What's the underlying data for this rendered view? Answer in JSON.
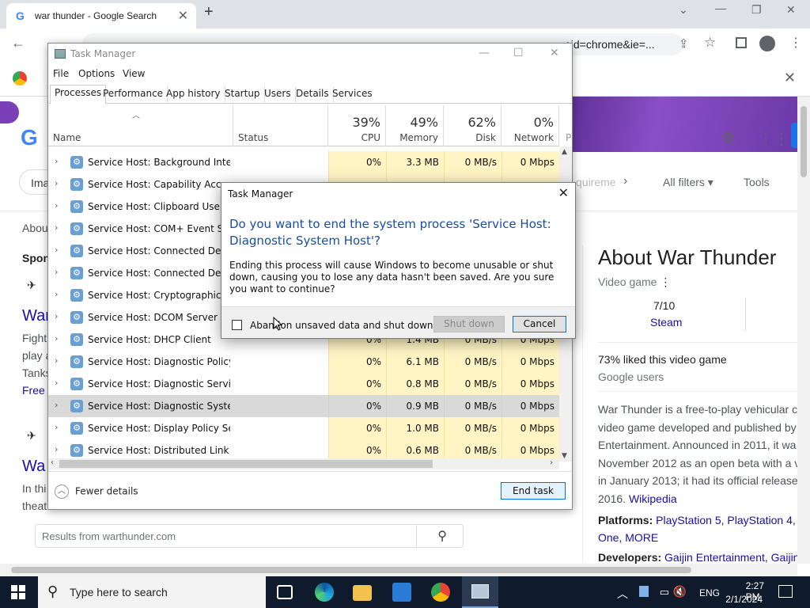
{
  "browser": {
    "tab_title": "war thunder - Google Search",
    "tab_favicon": "G",
    "omnibox_fragment": "eid=chrome&ie=..."
  },
  "page": {
    "images_tab": "Ima",
    "requirements_fragment": "quireme",
    "all_filters": "All filters",
    "tools": "Tools",
    "left_about": "Abou",
    "left_sponsored": "Spon",
    "left_link_1": "War",
    "left_text_1": "Fight",
    "left_text_2": "play a",
    "left_text_3": "Tanks",
    "left_free": "Free",
    "left_link_2": "Wa",
    "left_text_4": "In thi",
    "left_text_5": "theat",
    "results_from": "Results from warthunder.com"
  },
  "knowledge_panel": {
    "title": "About War Thunder",
    "subtitle": "Video game",
    "rating": "7/10",
    "rating_source": "Steam",
    "liked": "73% liked this video game",
    "liked_source": "Google users",
    "description_lines": [
      "War Thunder is a free-to-play vehicular c",
      "video game developed and published by",
      "Entertainment. Announced in 2011, it wa",
      "November 2012 as an open beta with a v",
      "in January 2013; it had its official release",
      "2016."
    ],
    "wikipedia": "Wikipedia",
    "platforms_label": "Platforms:",
    "platforms_value": "PlayStation 5, PlayStation 4,",
    "platforms_more": "One, MORE",
    "developers_label": "Developers:",
    "developers_value": "Gaijin Entertainment, Gaijin"
  },
  "task_manager": {
    "title": "Task Manager",
    "menu": [
      "File",
      "Options",
      "View"
    ],
    "tabs": [
      "Processes",
      "Performance",
      "App history",
      "Startup",
      "Users",
      "Details",
      "Services"
    ],
    "columns": {
      "name": "Name",
      "status": "Status",
      "cpu": {
        "pct": "39%",
        "label": "CPU"
      },
      "memory": {
        "pct": "49%",
        "label": "Memory"
      },
      "disk": {
        "pct": "62%",
        "label": "Disk"
      },
      "network": {
        "pct": "0%",
        "label": "Network"
      },
      "power_fragment": "P"
    },
    "rows": [
      {
        "name": "Service Host: Background Intelli...",
        "cpu": "0%",
        "mem": "3.3 MB",
        "disk": "0 MB/s",
        "net": "0 Mbps"
      },
      {
        "name": "Service Host: Capability Access ...",
        "cpu": "",
        "mem": "",
        "disk": "",
        "net": ""
      },
      {
        "name": "Service Host: Clipboard User Ser...",
        "cpu": "",
        "mem": "",
        "disk": "",
        "net": ""
      },
      {
        "name": "Service Host: COM+ Event Syste...",
        "cpu": "",
        "mem": "",
        "disk": "",
        "net": ""
      },
      {
        "name": "Service Host: Connected Device...",
        "cpu": "",
        "mem": "",
        "disk": "",
        "net": ""
      },
      {
        "name": "Service Host: Connected Device...",
        "cpu": "",
        "mem": "",
        "disk": "",
        "net": ""
      },
      {
        "name": "Service Host: Cryptographic Ser...",
        "cpu": "",
        "mem": "",
        "disk": "",
        "net": ""
      },
      {
        "name": "Service Host: DCOM Server Proc...",
        "cpu": "",
        "mem": "",
        "disk": "",
        "net": ""
      },
      {
        "name": "Service Host: DHCP Client",
        "cpu": "0%",
        "mem": "1.4 MB",
        "disk": "0 MB/s",
        "net": "0 Mbps"
      },
      {
        "name": "Service Host: Diagnostic Policy ...",
        "cpu": "0%",
        "mem": "6.1 MB",
        "disk": "0 MB/s",
        "net": "0 Mbps"
      },
      {
        "name": "Service Host: Diagnostic Service...",
        "cpu": "0%",
        "mem": "0.8 MB",
        "disk": "0 MB/s",
        "net": "0 Mbps"
      },
      {
        "name": "Service Host: Diagnostic System...",
        "cpu": "0%",
        "mem": "0.9 MB",
        "disk": "0 MB/s",
        "net": "0 Mbps"
      },
      {
        "name": "Service Host: Display Policy Serv...",
        "cpu": "0%",
        "mem": "1.0 MB",
        "disk": "0 MB/s",
        "net": "0 Mbps"
      },
      {
        "name": "Service Host: Distributed Link Tr...",
        "cpu": "0%",
        "mem": "0.6 MB",
        "disk": "0 MB/s",
        "net": "0 Mbps"
      }
    ],
    "fewer_details": "Fewer details",
    "end_task": "End task"
  },
  "dialog": {
    "title": "Task Manager",
    "heading": "Do you want to end the system process 'Service Host: Diagnostic System Host'?",
    "body": "Ending this process will cause Windows to become unusable or shut down, causing you to lose any data hasn't been saved. Are you sure you want to continue?",
    "checkbox_label": "Abandon unsaved data and shut down.",
    "shutdown_label": "Shut down",
    "cancel_label": "Cancel"
  },
  "taskbar": {
    "search_placeholder": "Type here to search",
    "language": "ENG",
    "time": "2:27 PM",
    "date": "2/1/2024"
  },
  "colors": {
    "accent": "#0078d7",
    "heatmap": "#fff4c4",
    "taskbar": "#0f1b2d"
  }
}
